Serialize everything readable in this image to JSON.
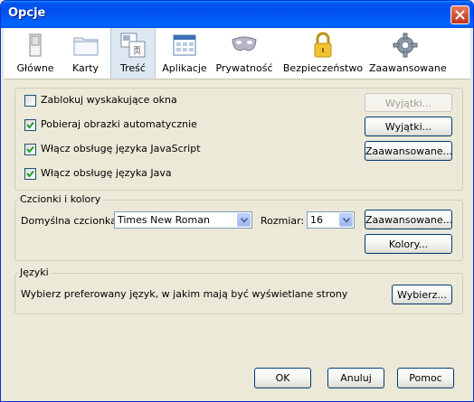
{
  "window": {
    "title": "Opcje"
  },
  "toolbar": {
    "items": [
      {
        "label": "Główne",
        "icon": "switch-icon"
      },
      {
        "label": "Karty",
        "icon": "folder-tabs-icon"
      },
      {
        "label": "Treść",
        "icon": "content-icon",
        "selected": true
      },
      {
        "label": "Aplikacje",
        "icon": "applications-icon"
      },
      {
        "label": "Prywatność",
        "icon": "mask-icon"
      },
      {
        "label": "Bezpieczeństwo",
        "icon": "padlock-icon"
      },
      {
        "label": "Zaawansowane",
        "icon": "gear-icon"
      }
    ]
  },
  "content": {
    "checkboxes": [
      {
        "label": "Zablokuj wyskakujące okna",
        "checked": false
      },
      {
        "label": "Pobieraj obrazki automatycznie",
        "checked": true
      },
      {
        "label": "Włącz obsługę języka JavaScript",
        "checked": true
      },
      {
        "label": "Włącz obsługę języka Java",
        "checked": true
      }
    ],
    "buttons": {
      "exceptions_popups": "Wyjątki...",
      "exceptions_images": "Wyjątki...",
      "advanced_js": "Zaawansowane..."
    }
  },
  "fonts": {
    "legend": "Czcionki i kolory",
    "default_font_label": "Domyślna czcionka:",
    "default_font_value": "Times New Roman",
    "size_label": "Rozmiar:",
    "size_value": "16",
    "advanced_button": "Zaawansowane...",
    "colors_button": "Kolory..."
  },
  "languages": {
    "legend": "Języki",
    "description": "Wybierz preferowany język, w jakim mają być wyświetlane strony",
    "choose_button": "Wybierz..."
  },
  "footer": {
    "ok": "OK",
    "cancel": "Anuluj",
    "help": "Pomoc"
  },
  "colors": {
    "titlebar": "#0054e3",
    "dialog_bg": "#ece9d8",
    "selected_tab": "#dde8f3"
  }
}
